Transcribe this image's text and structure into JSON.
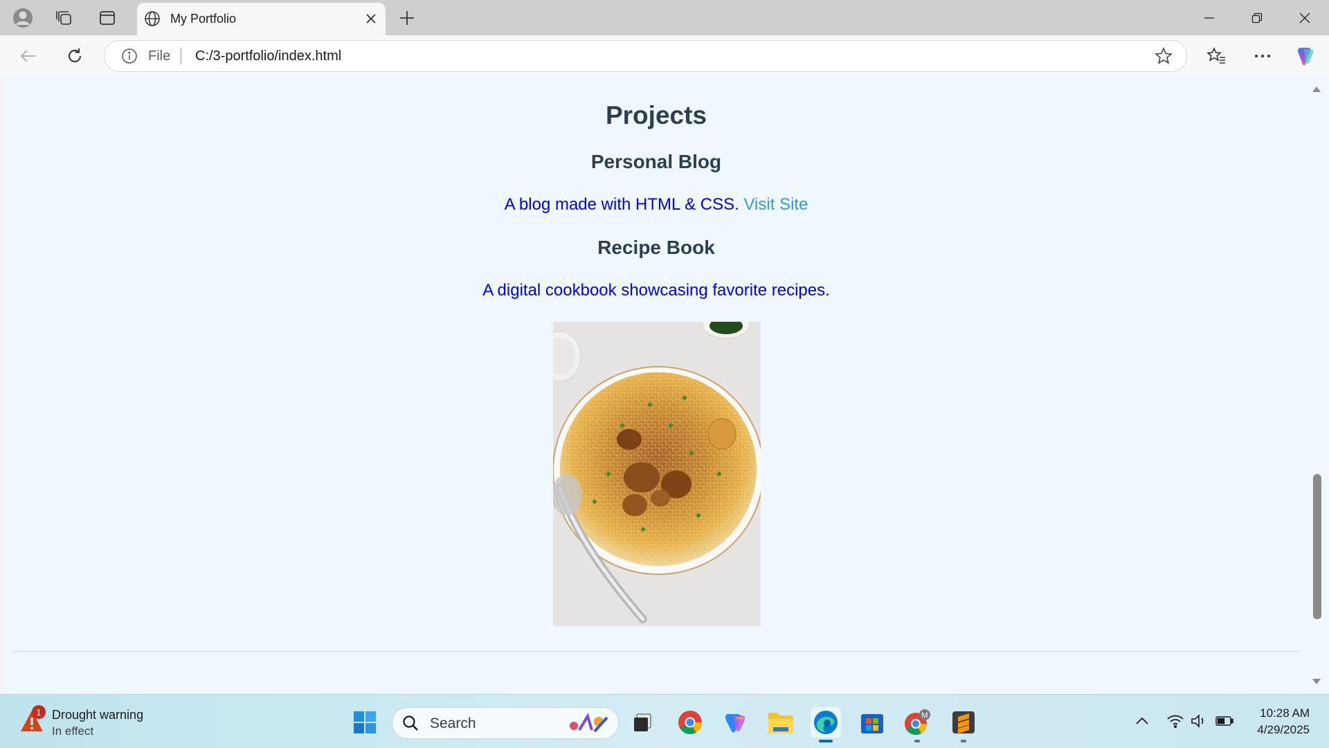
{
  "browser": {
    "tab": {
      "title": "My Portfolio"
    },
    "address": {
      "scheme": "File",
      "url": "C:/3-portfolio/index.html"
    }
  },
  "page": {
    "heading": "Projects",
    "projects": [
      {
        "title": "Personal Blog",
        "description": "A blog made with HTML & CSS. ",
        "link_text": "Visit Site"
      },
      {
        "title": "Recipe Book",
        "description": "A digital cookbook showcasing favorite recipes."
      }
    ],
    "colors": {
      "background": "#f0f8ff",
      "heading": "#2c3e50",
      "text": "#0000ee",
      "link": "#3498db"
    }
  },
  "taskbar": {
    "weather": {
      "badge": "1",
      "title": "Drought warning",
      "subtitle": "In effect"
    },
    "search": {
      "placeholder": "Search"
    },
    "clock": {
      "time": "10:28 AM",
      "date": "4/29/2025"
    },
    "profile_badge": "M"
  }
}
